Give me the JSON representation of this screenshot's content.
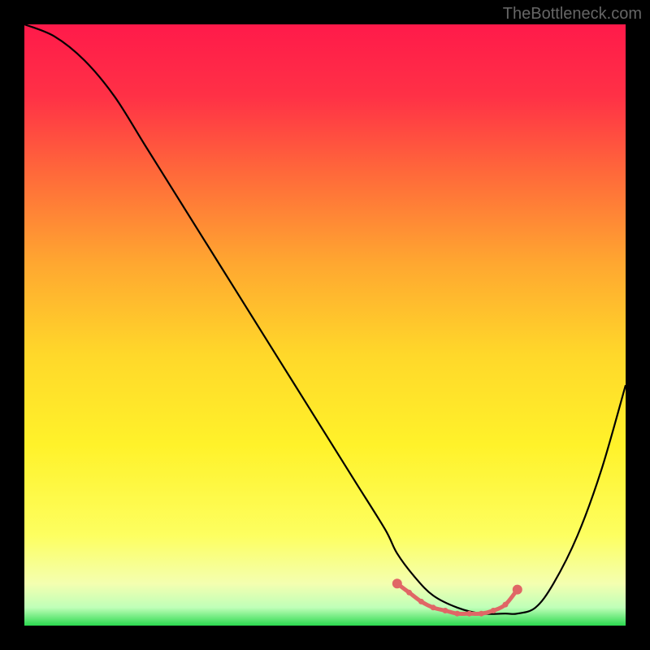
{
  "watermark": "TheBottleneck.com",
  "chart_data": {
    "type": "line",
    "title": "",
    "xlabel": "",
    "ylabel": "",
    "xlim": [
      0,
      100
    ],
    "ylim": [
      0,
      100
    ],
    "gradient_stops": [
      {
        "offset": 0,
        "color": "#ff1a4a"
      },
      {
        "offset": 12,
        "color": "#ff3146"
      },
      {
        "offset": 25,
        "color": "#ff6a3a"
      },
      {
        "offset": 40,
        "color": "#ffa830"
      },
      {
        "offset": 55,
        "color": "#ffd82a"
      },
      {
        "offset": 70,
        "color": "#fff22a"
      },
      {
        "offset": 85,
        "color": "#fdff60"
      },
      {
        "offset": 93,
        "color": "#f4ffb0"
      },
      {
        "offset": 97,
        "color": "#bfffb8"
      },
      {
        "offset": 100,
        "color": "#2bd94f"
      }
    ],
    "series": [
      {
        "name": "bottleneck-curve",
        "x": [
          0,
          5,
          10,
          15,
          20,
          25,
          30,
          35,
          40,
          45,
          50,
          55,
          60,
          62,
          65,
          68,
          72,
          76,
          80,
          82,
          85,
          88,
          92,
          96,
          100
        ],
        "y": [
          100,
          98,
          94,
          88,
          80,
          72,
          64,
          56,
          48,
          40,
          32,
          24,
          16,
          12,
          8,
          5,
          3,
          2,
          2,
          2,
          3,
          7,
          15,
          26,
          40
        ]
      }
    ],
    "highlight": {
      "name": "optimal-range",
      "color": "#e06666",
      "points": [
        {
          "x": 62,
          "y": 7
        },
        {
          "x": 64,
          "y": 5.5
        },
        {
          "x": 66,
          "y": 4
        },
        {
          "x": 68,
          "y": 3
        },
        {
          "x": 70,
          "y": 2.5
        },
        {
          "x": 72,
          "y": 2
        },
        {
          "x": 74,
          "y": 2
        },
        {
          "x": 76,
          "y": 2
        },
        {
          "x": 78,
          "y": 2.5
        },
        {
          "x": 80,
          "y": 3.5
        },
        {
          "x": 82,
          "y": 6
        }
      ]
    }
  }
}
